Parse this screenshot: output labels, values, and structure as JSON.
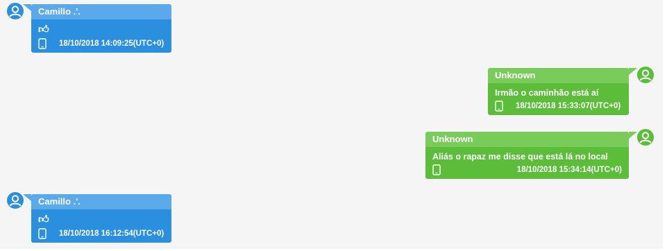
{
  "colors": {
    "incoming_header": "#5aa9ea",
    "incoming_body": "#2b8fe0",
    "outgoing_header": "#79cc5a",
    "outgoing_body": "#5cbd3b",
    "avatar_incoming": "#2b8fe0",
    "avatar_outgoing": "#5cbd3b"
  },
  "messages": [
    {
      "sender": "Camillo .'.",
      "direction": "incoming",
      "content_icon": "thumbs-up-icon",
      "content": "",
      "timestamp": "18/10/2018 14:09:25(UTC+0)",
      "device_icon": "phone-icon"
    },
    {
      "sender": "Unknown",
      "direction": "outgoing",
      "content": "Irmão o caminhão está aí",
      "timestamp": "18/10/2018 15:33:07(UTC+0)",
      "device_icon": "phone-icon"
    },
    {
      "sender": "Unknown",
      "direction": "outgoing",
      "content": "Aliás o rapaz me disse que está lá no local",
      "timestamp": "18/10/2018 15:34:14(UTC+0)",
      "device_icon": "phone-icon"
    },
    {
      "sender": "Camillo .'.",
      "direction": "incoming",
      "content_icon": "thumbs-up-icon",
      "content": "",
      "timestamp": "18/10/2018 16:12:54(UTC+0)",
      "device_icon": "phone-icon"
    }
  ]
}
